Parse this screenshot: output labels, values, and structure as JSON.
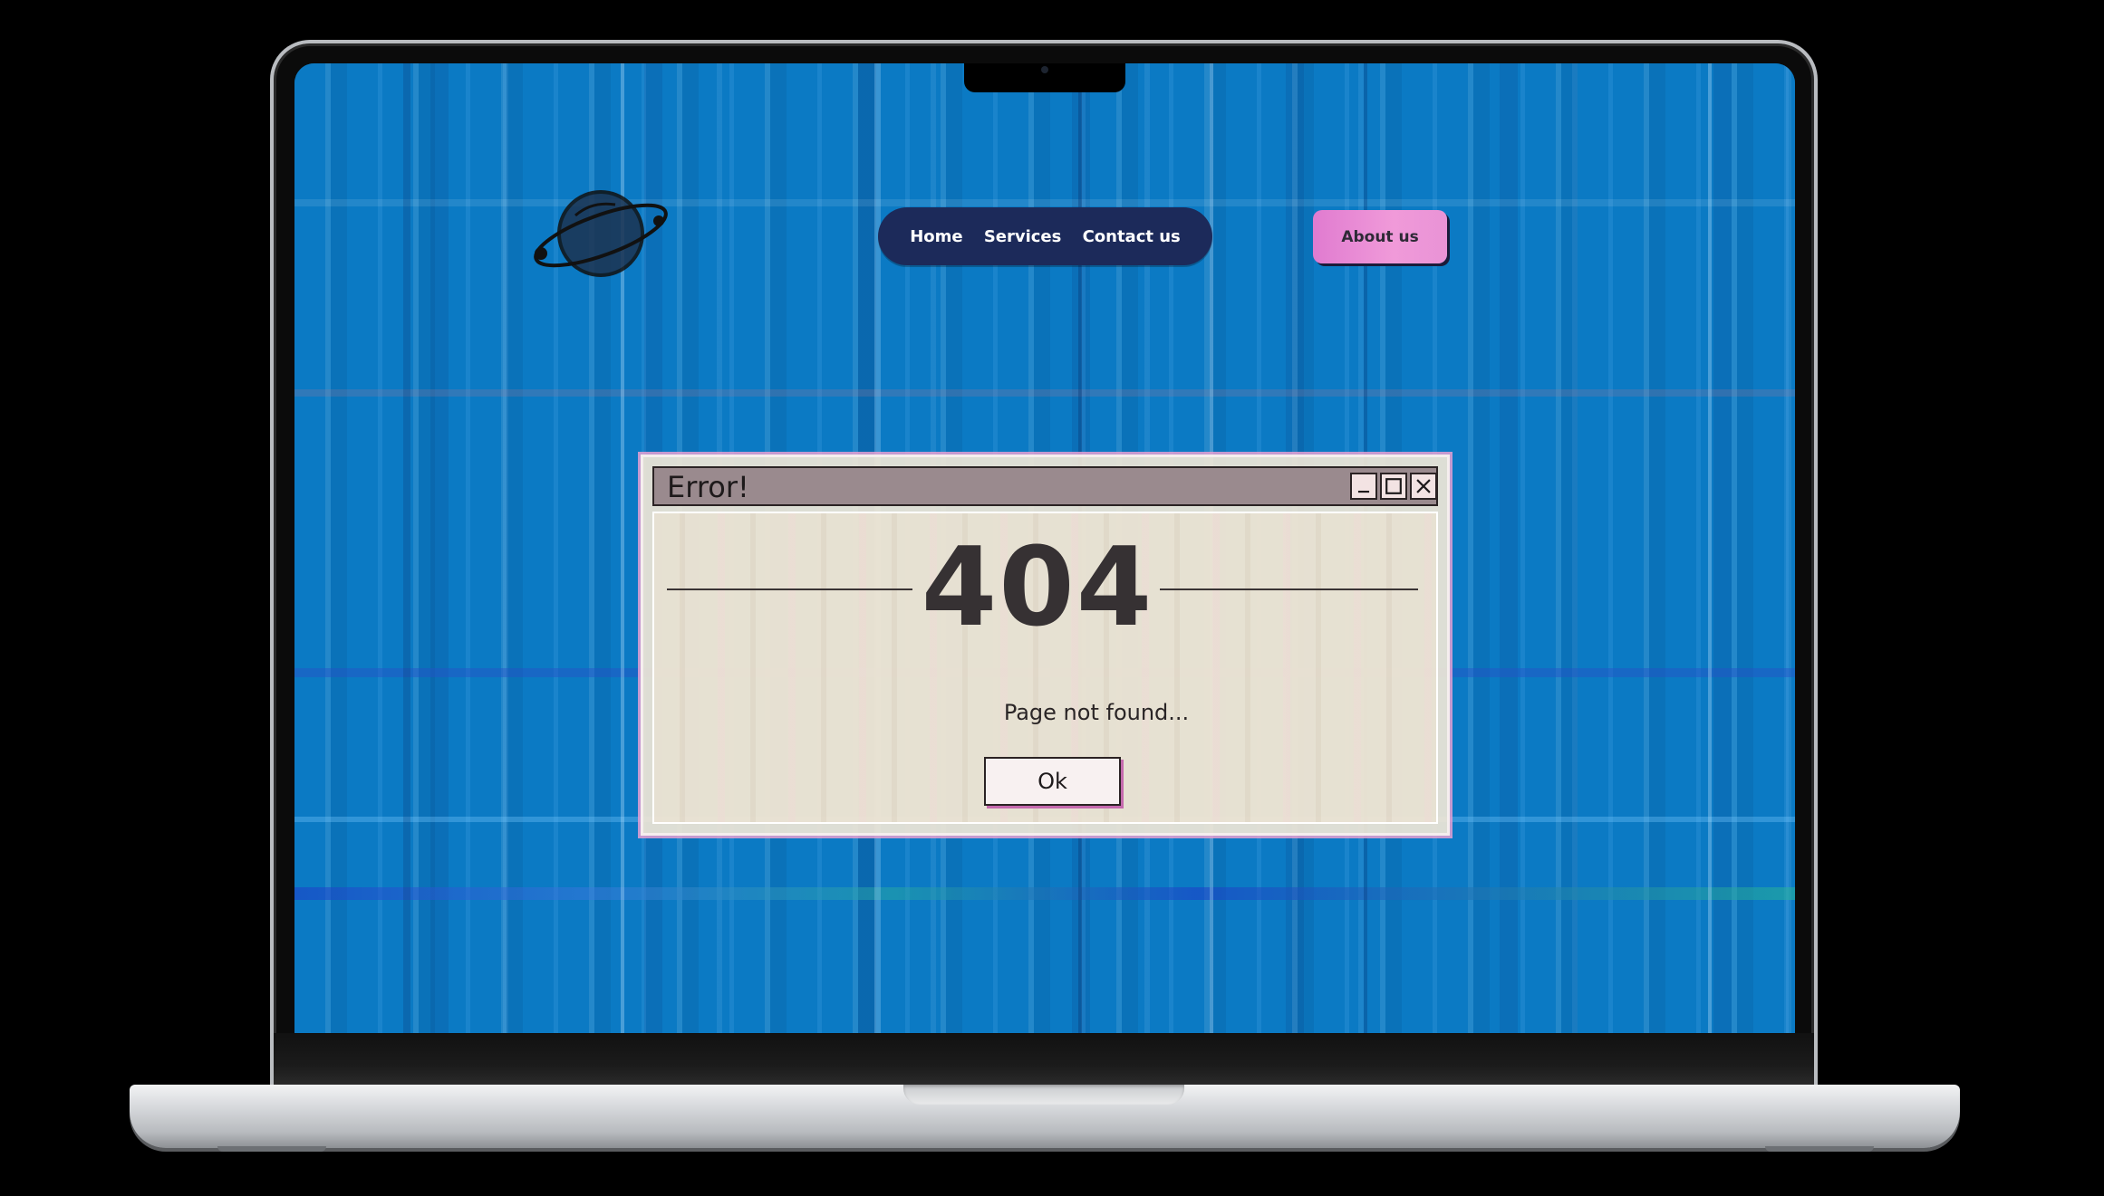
{
  "header": {
    "logo_icon": "planet-icon",
    "nav": [
      {
        "label": "Home"
      },
      {
        "label": "Services"
      },
      {
        "label": "Contact us"
      }
    ],
    "about_label": "About us"
  },
  "dialog": {
    "title": "Error!",
    "code": "404",
    "message": "Page not found...",
    "ok_label": "Ok",
    "window_icons": [
      "minimize-icon",
      "maximize-icon",
      "close-icon"
    ]
  },
  "colors": {
    "background": "#0b7ac4",
    "nav_bg": "#1c2a5a",
    "about_gradient_start": "#e07bd0",
    "about_gradient_end": "#f09ad9",
    "dialog_bg": "#f0e6d6",
    "titlebar": "#9a8a8e"
  }
}
